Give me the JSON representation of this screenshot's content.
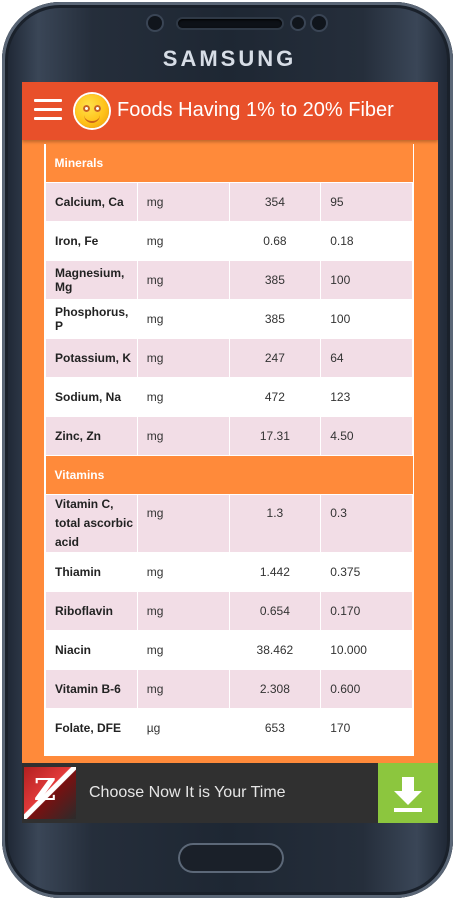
{
  "device": {
    "brand": "SAMSUNG"
  },
  "app_bar": {
    "title": "Foods Having 1% to 20% Fiber",
    "menu_icon": "hamburger-icon",
    "logo_icon": "smiley-logo-icon"
  },
  "table": {
    "sections": [
      {
        "title": "Minerals",
        "rows": [
          {
            "name": "Calcium, Ca",
            "unit": "mg",
            "value": "354",
            "per_serving": "95"
          },
          {
            "name": "Iron, Fe",
            "unit": "mg",
            "value": "0.68",
            "per_serving": "0.18"
          },
          {
            "name": "Magnesium, Mg",
            "unit": "mg",
            "value": "385",
            "per_serving": "100"
          },
          {
            "name": "Phosphorus, P",
            "unit": "mg",
            "value": "385",
            "per_serving": "100"
          },
          {
            "name": "Potassium, K",
            "unit": "mg",
            "value": "247",
            "per_serving": "64"
          },
          {
            "name": "Sodium, Na",
            "unit": "mg",
            "value": "472",
            "per_serving": "123"
          },
          {
            "name": "Zinc, Zn",
            "unit": "mg",
            "value": "17.31",
            "per_serving": "4.50"
          }
        ]
      },
      {
        "title": "Vitamins",
        "rows": [
          {
            "name": "Vitamin C, total ascorbic acid",
            "unit": "mg",
            "value": "1.3",
            "per_serving": "0.3"
          },
          {
            "name": "Thiamin",
            "unit": "mg",
            "value": "1.442",
            "per_serving": "0.375"
          },
          {
            "name": "Riboflavin",
            "unit": "mg",
            "value": "0.654",
            "per_serving": "0.170"
          },
          {
            "name": "Niacin",
            "unit": "mg",
            "value": "38.462",
            "per_serving": "10.000"
          },
          {
            "name": "Vitamin B-6",
            "unit": "mg",
            "value": "2.308",
            "per_serving": "0.600"
          },
          {
            "name": "Folate, DFE",
            "unit": "µg",
            "value": "653",
            "per_serving": "170"
          }
        ]
      }
    ]
  },
  "ad": {
    "text": "Choose Now It is Your Time",
    "thumb_letter": "Z",
    "download_icon": "download-icon"
  },
  "colors": {
    "app_bar": "#e8502a",
    "accent": "#ff8a3a",
    "row_alt": "#f2dde6",
    "ad_bar": "#303030",
    "download_button": "#8cc63e"
  }
}
